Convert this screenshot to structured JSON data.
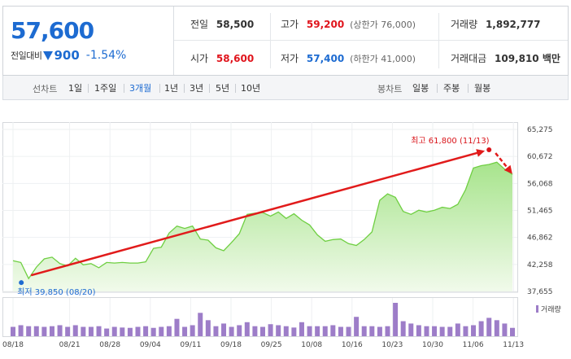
{
  "summary": {
    "price": "57,600",
    "change_label": "전일대비",
    "change_value": "900",
    "change_pct": "-1.54%",
    "direction": "down",
    "colors": {
      "up": "#e0151d",
      "down": "#1d6bd1"
    },
    "stats": {
      "prev_close": {
        "label": "전일",
        "value": "58,500"
      },
      "high": {
        "label": "고가",
        "value": "59,200",
        "note": "(상한가 76,000)"
      },
      "volume": {
        "label": "거래량",
        "value": "1,892,777"
      },
      "open": {
        "label": "시가",
        "value": "58,600"
      },
      "low": {
        "label": "저가",
        "value": "57,400",
        "note": "(하한가 41,000)"
      },
      "amount": {
        "label": "거래대금",
        "value": "109,810 백만"
      }
    }
  },
  "tabs": {
    "line_label": "선차트",
    "line_items": [
      "1일",
      "1주일",
      "3개월",
      "1년",
      "3년",
      "5년",
      "10년"
    ],
    "active": "3개월",
    "candle_label": "봉차트",
    "candle_items": [
      "일봉",
      "주봉",
      "월봉"
    ]
  },
  "chart_data": {
    "type": "area",
    "x_ticks": [
      "08/18",
      "08/21",
      "08/28",
      "09/04",
      "09/11",
      "09/18",
      "09/25",
      "10/08",
      "10/16",
      "10/23",
      "10/30",
      "11/06",
      "11/13"
    ],
    "y_ticks": [
      "65,275",
      "60,672",
      "56,068",
      "51,465",
      "46,862",
      "42,258",
      "37,655"
    ],
    "ylim": [
      37655,
      65275
    ],
    "price": [
      42900,
      42600,
      39850,
      41800,
      43200,
      43500,
      42400,
      42000,
      43300,
      42200,
      42400,
      41700,
      42600,
      42500,
      42600,
      42500,
      42500,
      42700,
      45000,
      45200,
      47600,
      48800,
      48400,
      48800,
      46600,
      46400,
      45100,
      44600,
      46000,
      47500,
      50800,
      51000,
      51100,
      50500,
      51200,
      50100,
      50900,
      49800,
      49000,
      47300,
      46200,
      46500,
      46600,
      45800,
      45500,
      46500,
      47800,
      53200,
      54300,
      53700,
      51300,
      50800,
      51500,
      51200,
      51500,
      52000,
      51800,
      52500,
      55000,
      58700,
      59100,
      59300,
      59700,
      58500,
      57600
    ],
    "volume_legend": "거래량",
    "volume": [
      0.28,
      0.33,
      0.3,
      0.3,
      0.28,
      0.3,
      0.33,
      0.28,
      0.33,
      0.28,
      0.28,
      0.3,
      0.23,
      0.28,
      0.26,
      0.25,
      0.28,
      0.3,
      0.25,
      0.28,
      0.3,
      0.52,
      0.28,
      0.33,
      0.7,
      0.48,
      0.3,
      0.38,
      0.28,
      0.33,
      0.42,
      0.3,
      0.28,
      0.36,
      0.33,
      0.3,
      0.26,
      0.42,
      0.3,
      0.3,
      0.3,
      0.33,
      0.28,
      0.28,
      0.58,
      0.3,
      0.3,
      0.28,
      0.3,
      1.0,
      0.45,
      0.38,
      0.33,
      0.3,
      0.3,
      0.28,
      0.28,
      0.38,
      0.3,
      0.33,
      0.45,
      0.55,
      0.48,
      0.38,
      0.25
    ],
    "annotations": {
      "high": {
        "text": "최고 61,800 (11/13)",
        "value": 61800,
        "color": "#d9141a"
      },
      "low": {
        "text": "최저 39,850 (08/20)",
        "value": 39850,
        "color": "#1d6bd1"
      }
    },
    "grid": true
  }
}
